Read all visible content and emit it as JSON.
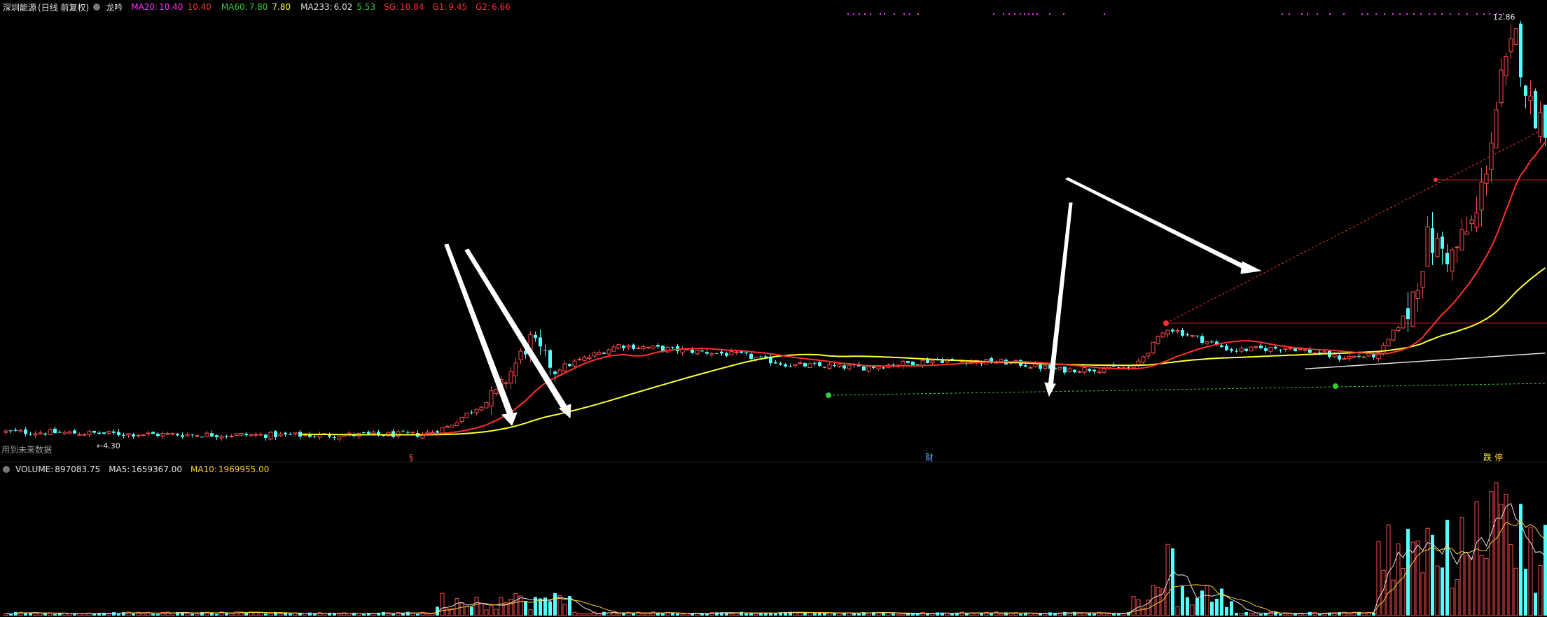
{
  "header": {
    "stock_name": "深圳能源",
    "period_label": "(日线 前复权)",
    "indicator_name": "龙吟",
    "ma20_label": "MA20:",
    "ma20_value": "10.40",
    "ma20_value2": "10.40",
    "ma60_label": "MA60:",
    "ma60_value": "7.80",
    "ma60_value2": "7.80",
    "ma233_label": "MA233:",
    "ma233_value": "6.02",
    "ma233_value2": "5.53",
    "sg_label": "SG:",
    "sg_value": "10.84",
    "g1_label": "G1:",
    "g1_value": "9.45",
    "g2_label": "G2:",
    "g2_value": "6.66"
  },
  "main_panel": {
    "high_label": "12.86",
    "low_label": "4.30",
    "future_data_note": "用到未来数据",
    "marker_s": "§",
    "marker_cai": "财",
    "marker_die": "跌",
    "marker_ting": "停"
  },
  "volume_panel": {
    "volume_label": "VOLUME:",
    "volume_value": "897083.75",
    "ma5_label": "MA5:",
    "ma5_value": "1659367.00",
    "ma10_label": "MA10:",
    "ma10_value": "1969955.00"
  },
  "colors": {
    "background": "#000000",
    "up_candle": "#ff4d4d",
    "down_candle": "#54ffff",
    "ma20": "#ff3030",
    "ma60": "#ffff33",
    "ma233": "#e0e0e0",
    "support_line": "#33cc33",
    "magenta": "#ff33ff"
  },
  "chart_data": {
    "type": "candlestick",
    "price_axis_range": [
      4.3,
      12.86
    ],
    "series_summary": {
      "start_close": 4.35,
      "breakout_1_high": 6.6,
      "consolidation_range": [
        5.6,
        6.3
      ],
      "breakout_2_high": 7.1,
      "final_high": 12.86
    },
    "volume_series": {
      "name": "VOLUME",
      "last_value": 897083.75,
      "ma5": 1659367.0,
      "ma10": 1969955.0
    }
  }
}
